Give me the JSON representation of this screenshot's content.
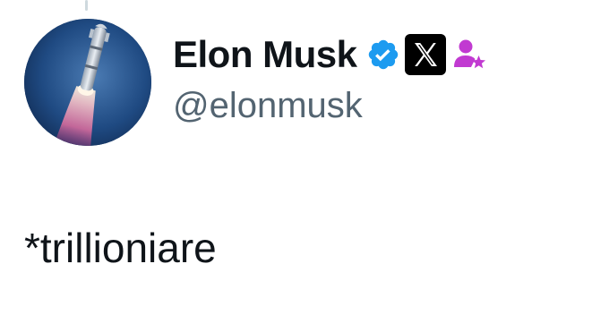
{
  "author": {
    "display_name": "Elon Musk",
    "handle": "@elonmusk",
    "avatar_icon": "rocket-launch-avatar",
    "badges": [
      {
        "name": "verified-badge-icon",
        "color": "#1d9bf0"
      },
      {
        "name": "x-logo-affiliate-icon",
        "color": "#000000"
      },
      {
        "name": "user-star-icon",
        "color": "#c13ad1"
      }
    ]
  },
  "post": {
    "text": "*trillioniare"
  },
  "colors": {
    "text_primary": "#0f1419",
    "text_secondary": "#536471",
    "verified_blue": "#1d9bf0",
    "thread_line": "#cfd9de"
  }
}
